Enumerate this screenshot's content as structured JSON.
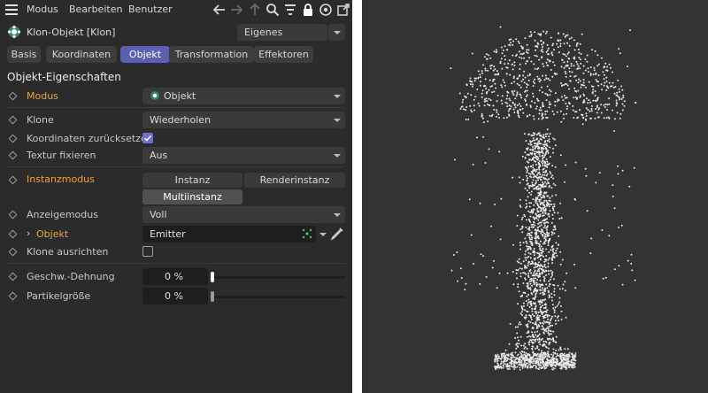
{
  "menu": {
    "items": [
      "Modus",
      "Bearbeiten",
      "Benutzer"
    ]
  },
  "toolbar": {
    "icons": [
      "back-arrow-icon",
      "forward-arrow-icon",
      "up-arrow-icon",
      "search-icon",
      "filter-icon",
      "lock-icon",
      "target-icon",
      "new-window-icon"
    ]
  },
  "object": {
    "title": "Klon-Objekt [Klon]",
    "mode_dropdown": "Eigenes"
  },
  "tabs": [
    {
      "label": "Basis",
      "active": false
    },
    {
      "label": "Koordinaten",
      "active": false
    },
    {
      "label": "Objekt",
      "active": true
    },
    {
      "label": "Transformation",
      "active": false
    },
    {
      "label": "Effektoren",
      "active": false
    }
  ],
  "section_title": "Objekt-Eigenschaften",
  "props": {
    "modus": {
      "label": "Modus",
      "value": "Objekt"
    },
    "klone": {
      "label": "Klone",
      "value": "Wiederholen"
    },
    "koord_reset": {
      "label": "Koordinaten zurücksetzen",
      "checked": true
    },
    "textur": {
      "label": "Textur fixieren",
      "value": "Aus"
    },
    "instanzmodus": {
      "label": "Instanzmodus",
      "options": [
        "Instanz",
        "Renderinstanz",
        "Multiinstanz"
      ],
      "selected": "Multiinstanz"
    },
    "anzeigemodus": {
      "label": "Anzeigemodus",
      "value": "Voll"
    },
    "objekt": {
      "label": "Objekt",
      "value": "Emitter"
    },
    "klone_ausrichten": {
      "label": "Klone ausrichten",
      "checked": false
    },
    "dehnung": {
      "label": "Geschw.-Dehnung",
      "value": "0 %",
      "level": 0
    },
    "partikelgroesse": {
      "label": "Partikelgröße",
      "value": "0 %",
      "level": 0
    }
  },
  "colors": {
    "panel_bg": "#2b2b2b",
    "accent_tab": "#5a5fb0",
    "orange_label": "#f0a040",
    "viewport_bg": "#333333",
    "particle": "#e8e8e8"
  }
}
